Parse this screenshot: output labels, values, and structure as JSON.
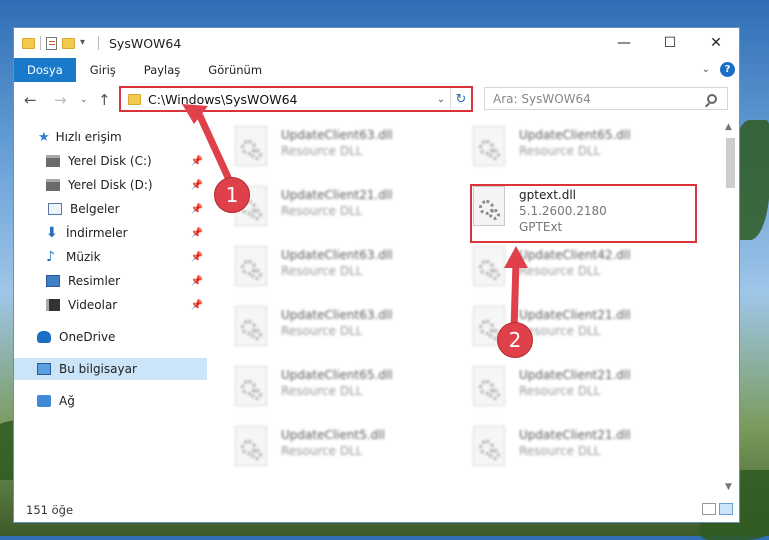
{
  "window": {
    "title": "SysWOW64",
    "controls": {
      "minimize": "—",
      "maximize": "☐",
      "close": "✕"
    }
  },
  "ribbon": {
    "tabs": [
      "Dosya",
      "Giriş",
      "Paylaş",
      "Görünüm"
    ],
    "expand_icon": "chevron-down-icon",
    "help_label": "?"
  },
  "address": {
    "path": "C:\\Windows\\SysWOW64",
    "search_placeholder": "Ara: SysWOW64"
  },
  "sidebar": {
    "items": [
      {
        "label": "Hızlı erişim",
        "icon": "star-icon",
        "pinned": false
      },
      {
        "label": "Yerel Disk (C:)",
        "icon": "drive-icon",
        "pinned": true
      },
      {
        "label": "Yerel Disk (D:)",
        "icon": "drive-icon",
        "pinned": true
      },
      {
        "label": "Belgeler",
        "icon": "documents-icon",
        "pinned": true
      },
      {
        "label": "İndirmeler",
        "icon": "downloads-icon",
        "pinned": true
      },
      {
        "label": "Müzik",
        "icon": "music-icon",
        "pinned": true
      },
      {
        "label": "Resimler",
        "icon": "pictures-icon",
        "pinned": true
      },
      {
        "label": "Videolar",
        "icon": "videos-icon",
        "pinned": true
      },
      {
        "label": "OneDrive",
        "icon": "onedrive-icon",
        "pinned": false
      },
      {
        "label": "Bu bilgisayar",
        "icon": "pc-icon",
        "pinned": false,
        "selected": true
      },
      {
        "label": "Ağ",
        "icon": "network-icon",
        "pinned": false
      }
    ]
  },
  "files": {
    "left_column": [
      {
        "name": "UpdateClient63.dll",
        "type": "Resource DLL"
      },
      {
        "name": "UpdateClient21.dll",
        "type": "Resource DLL"
      },
      {
        "name": "UpdateClient63.dll",
        "type": "Resource DLL"
      },
      {
        "name": "UpdateClient63.dll",
        "type": "Resource DLL"
      },
      {
        "name": "UpdateClient65.dll",
        "type": "Resource DLL"
      },
      {
        "name": "UpdateClient5.dll",
        "type": "Resource DLL"
      }
    ],
    "right_column": [
      {
        "name": "UpdateClient65.dll",
        "type": "Resource DLL"
      },
      {
        "name": "gptext.dll",
        "version": "5.1.2600.2180",
        "type": "GPTExt",
        "highlighted": true
      },
      {
        "name": "UpdateClient42.dll",
        "type": "Resource DLL"
      },
      {
        "name": "UpdateClient21.dll",
        "type": "Resource DLL"
      },
      {
        "name": "UpdateClient21.dll",
        "type": "Resource DLL"
      },
      {
        "name": "UpdateClient21.dll",
        "type": "Resource DLL"
      }
    ]
  },
  "status": {
    "item_count": "151 öğe"
  },
  "annotations": {
    "callout1": "1",
    "callout2": "2",
    "accent_color": "#e0404a"
  }
}
